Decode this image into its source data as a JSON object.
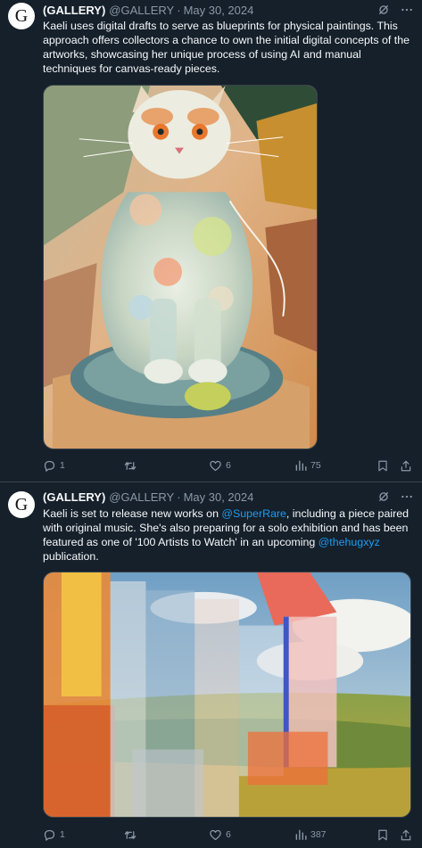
{
  "tweets": [
    {
      "avatar_letter": "G",
      "name": "(GALLERY)",
      "handle": "@GALLERY",
      "separator": "·",
      "date": "May 30, 2024",
      "text": "Kaeli uses digital drafts to serve as blueprints for physical paintings. This approach offers collectors a chance to own the initial digital concepts of the artworks, showcasing her unique process of using AI and manual techniques for canvas-ready pieces.",
      "media_icon": "painting-cat-glass-sculpture",
      "stats": {
        "replies": "1",
        "reposts": "",
        "likes": "6",
        "views": "75"
      }
    },
    {
      "avatar_letter": "G",
      "name": "(GALLERY)",
      "handle": "@GALLERY",
      "separator": "·",
      "date": "May 30, 2024",
      "text_parts": {
        "p1": "Kaeli is set to release new works on ",
        "mention1": "@SuperRare",
        "p2": ", including a piece paired with original music. She's also preparing for a solo exhibition and has been featured as one of '100 Artists to Watch' in an upcoming ",
        "mention2": "@thehugxyz",
        "p3": " publication."
      },
      "media_icon": "painting-glass-house-landscape",
      "stats": {
        "replies": "1",
        "reposts": "",
        "likes": "6",
        "views": "387"
      }
    }
  ],
  "colors": {
    "background": "#15202b",
    "divider": "#38444d",
    "text_primary": "#f7f9f9",
    "text_secondary": "#8b98a5",
    "link": "#1d9bf0"
  }
}
